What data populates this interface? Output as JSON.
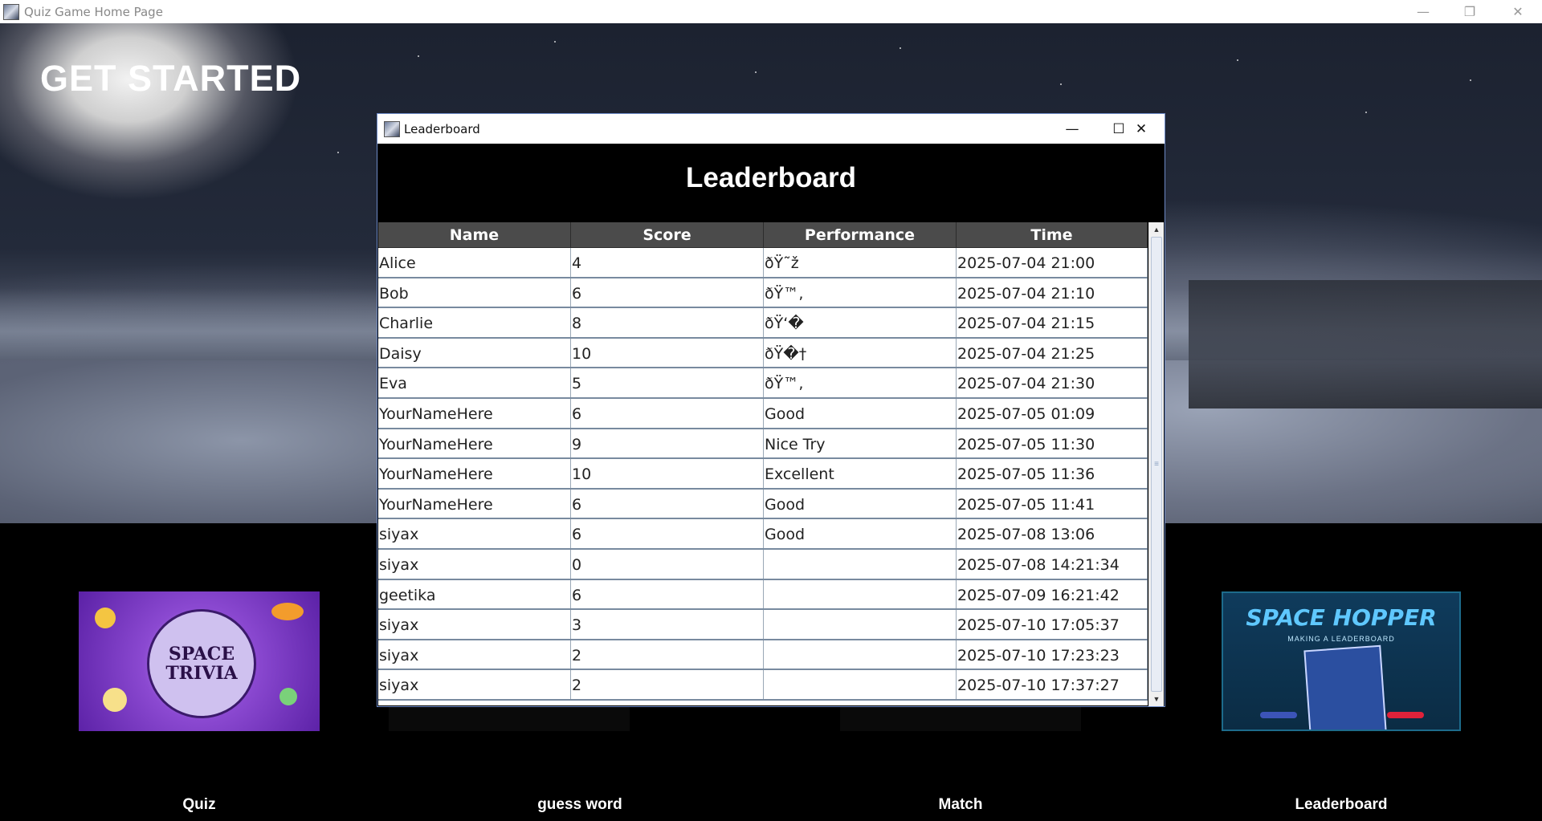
{
  "window": {
    "title": "Quiz Game Home Page",
    "controls": {
      "minimize": "—",
      "restore": "❐",
      "close": "✕"
    }
  },
  "hero": {
    "heading": "GET STARTED"
  },
  "cards": [
    {
      "label": "Quiz",
      "image_text": [
        "SPACE",
        "TRIVIA"
      ]
    },
    {
      "label": "guess word"
    },
    {
      "label": "Match"
    },
    {
      "label": "Leaderboard",
      "image_title": "SPACE HOPPER",
      "image_sub": "MAKING A LEADERBOARD"
    }
  ],
  "dialog": {
    "title": "Leaderboard",
    "heading": "Leaderboard",
    "controls": {
      "minimize": "—",
      "maximize": "☐",
      "close": "✕"
    },
    "columns": [
      "Name",
      "Score",
      "Performance",
      "Time"
    ],
    "rows": [
      [
        "Alice",
        "4",
        "ðŸ˜ž",
        "2025-07-04 21:00"
      ],
      [
        "Bob",
        "6",
        "ðŸ™‚",
        "2025-07-04 21:10"
      ],
      [
        "Charlie",
        "8",
        "ðŸ‘�",
        "2025-07-04 21:15"
      ],
      [
        "Daisy",
        "10",
        "ðŸ�†",
        "2025-07-04 21:25"
      ],
      [
        "Eva",
        "5",
        "ðŸ™‚",
        "2025-07-04 21:30"
      ],
      [
        "YourNameHere",
        "6",
        "Good",
        "2025-07-05 01:09"
      ],
      [
        "YourNameHere",
        "9",
        "Nice Try",
        "2025-07-05 11:30"
      ],
      [
        "YourNameHere",
        "10",
        "Excellent",
        "2025-07-05 11:36"
      ],
      [
        "YourNameHere",
        "6",
        "Good",
        "2025-07-05 11:41"
      ],
      [
        "siyax",
        "6",
        "Good",
        "2025-07-08 13:06"
      ],
      [
        "siyax",
        "0",
        "",
        "2025-07-08 14:21:34"
      ],
      [
        "geetika",
        "6",
        "",
        "2025-07-09 16:21:42"
      ],
      [
        "siyax",
        "3",
        "",
        "2025-07-10 17:05:37"
      ],
      [
        "siyax",
        "2",
        "",
        "2025-07-10 17:23:23"
      ],
      [
        "siyax",
        "2",
        "",
        "2025-07-10 17:37:27"
      ]
    ]
  },
  "colors": {
    "dialog_bg": "#000000",
    "header_bg": "#4b4b4b",
    "row_border": "#788a9f",
    "accent_border": "#6d8ac7"
  }
}
